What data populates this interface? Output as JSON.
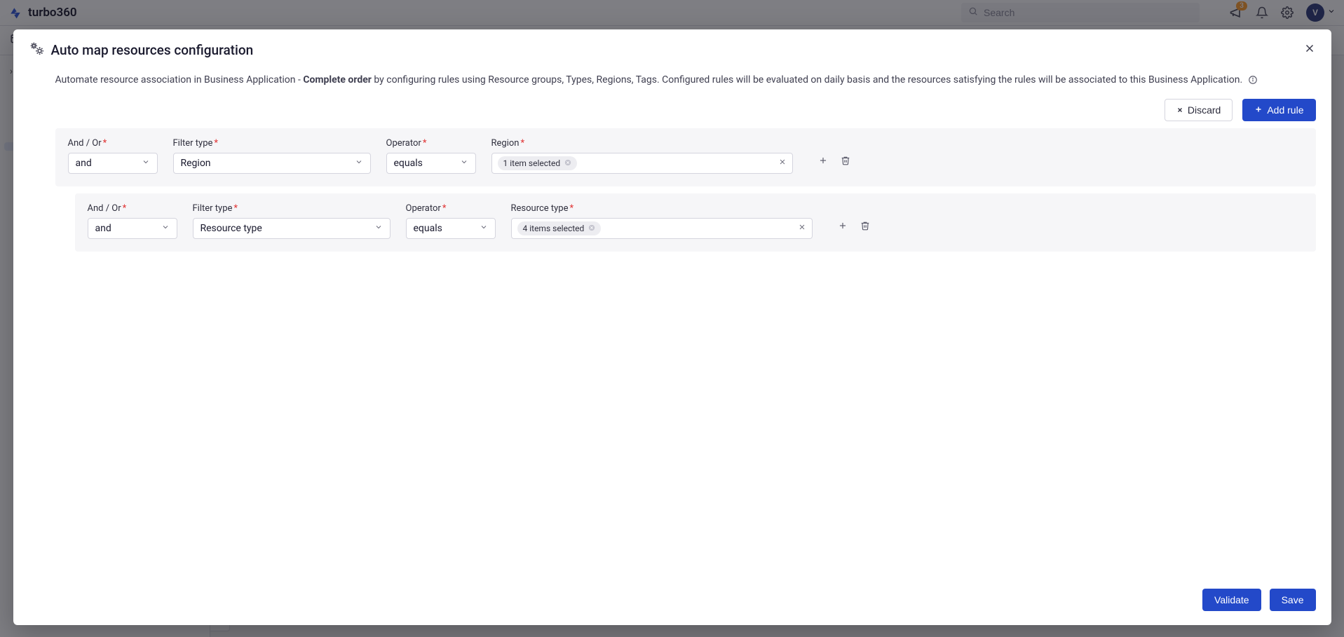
{
  "brand": "turbo360",
  "search": {
    "placeholder": "Search"
  },
  "notifications": {
    "count": "3"
  },
  "avatar": {
    "initial": "V"
  },
  "secondbar": {
    "label": "B"
  },
  "modal": {
    "title": "Auto map resources configuration",
    "desc_prefix": "Automate resource association in Business Application - ",
    "desc_bold": "Complete order",
    "desc_suffix": " by configuring rules using Resource groups, Types, Regions, Tags. Configured rules will be evaluated on daily basis and the resources satisfying the rules will be associated to this Business Application.",
    "discard_label": "Discard",
    "add_rule_label": "Add rule",
    "validate_label": "Validate",
    "save_label": "Save"
  },
  "labels": {
    "and_or": "And / Or",
    "filter_type": "Filter type",
    "operator": "Operator",
    "region": "Region",
    "resource_type": "Resource type"
  },
  "rules": {
    "r1": {
      "and_or": "and",
      "filter_type": "Region",
      "operator": "equals",
      "value_chip": "1 item selected"
    },
    "r2": {
      "and_or": "and",
      "filter_type": "Resource type",
      "operator": "equals",
      "value_chip": "4 items selected"
    }
  }
}
